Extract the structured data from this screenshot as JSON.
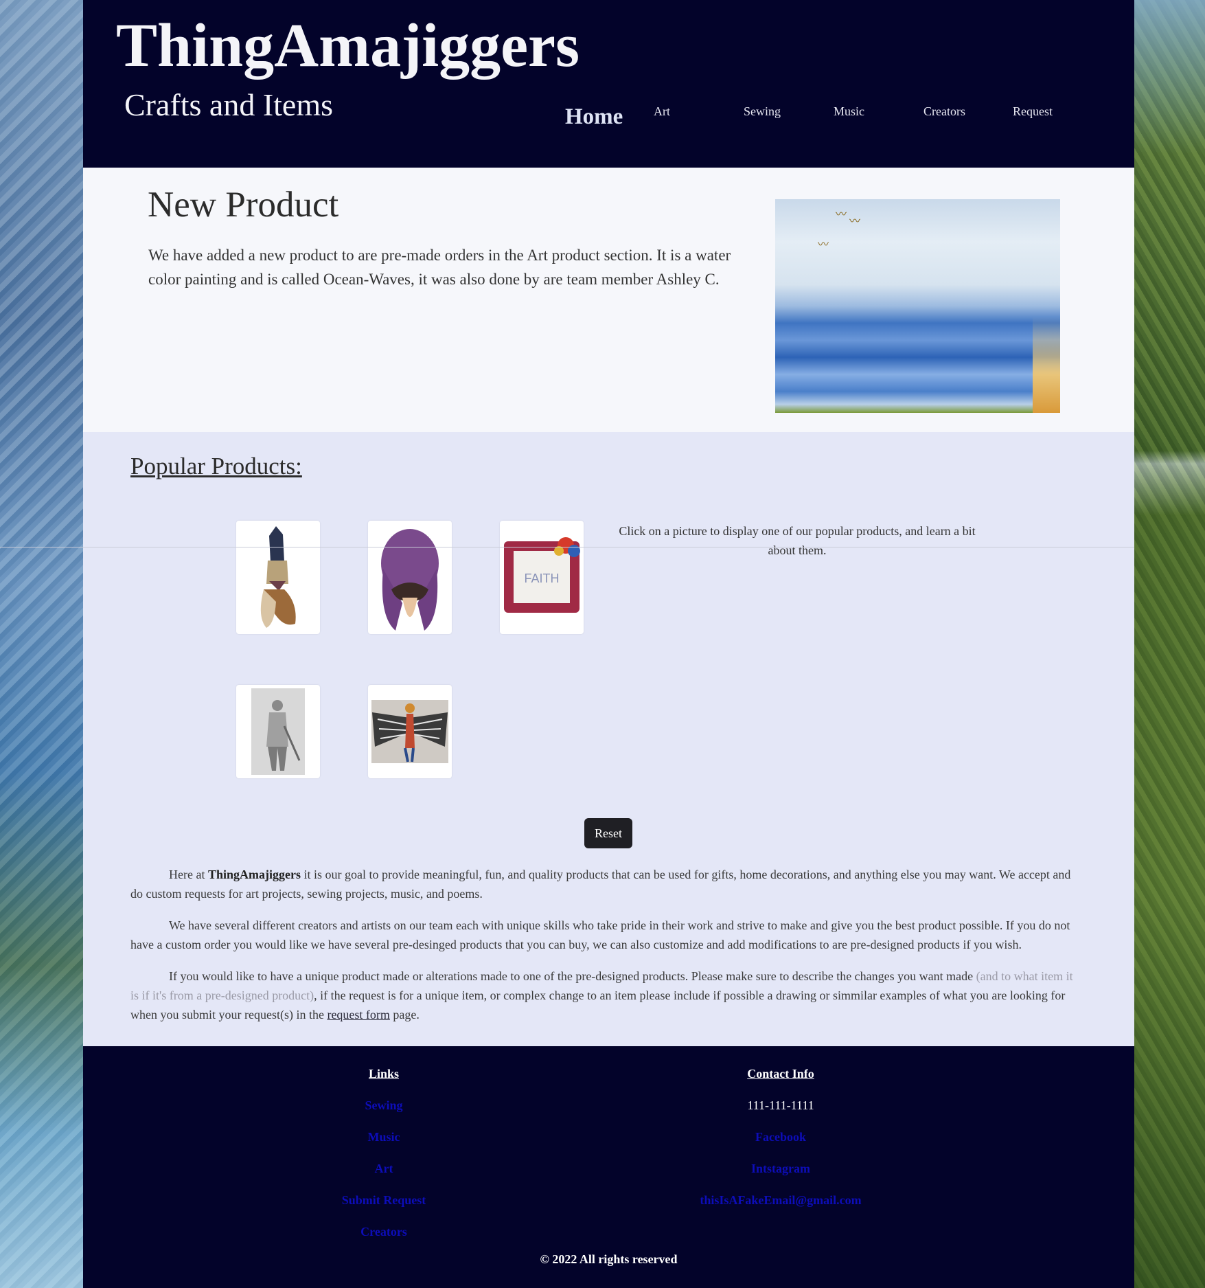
{
  "header": {
    "brand": "ThingAmajiggers",
    "tagline": "Crafts and Items",
    "nav": {
      "home": "Home",
      "art": "Art",
      "sewing": "Sewing",
      "music": "Music",
      "creators": "Creators",
      "request": "Request"
    }
  },
  "new_product": {
    "title": "New Product",
    "text": "We have added a new product to are pre-made orders in the Art product section. It is a water color painting and is called Ocean-Waves, it was also done by are team member Ashley C.",
    "image_icon": "ocean-waves-painting"
  },
  "popular": {
    "heading": "Popular Products:",
    "hint": "Click on a picture to display one of our popular products, and learn a bit about them.",
    "thumbs": [
      {
        "icon": "gnome-thumbnail"
      },
      {
        "icon": "purple-plush-thumbnail"
      },
      {
        "icon": "faith-pillow-thumbnail"
      },
      {
        "icon": "pencil-drawing-thumbnail"
      },
      {
        "icon": "winged-figure-thumbnail"
      }
    ],
    "pillow_text": "FAITH",
    "reset_label": "Reset"
  },
  "about": {
    "p1_pre": "Here at ",
    "p1_brand": "ThingAmajiggers",
    "p1_post": " it is our goal to provide meaningful, fun, and quality products that can be used for gifts, home decorations, and anything else you may want. We accept and do custom requests for art projects, sewing projects, music, and poems.",
    "p2": "We have several different creators and artists on our team each with unique skills who take pride in their work and strive to make and give you the best product possible. If you do not have a custom order you would like we have several pre-desinged products that you can buy, we can also customize and add modifications to are pre-designed products if you wish.",
    "p3_pre": "If you would like to have a unique product made or alterations made to one of the pre-designed products. Please make sure to describe the changes you want made ",
    "p3_muted": "(and to what item it is if it's from a pre-designed product)",
    "p3_mid": ", if the request is for a unique item, or complex change to an item please include if possible a drawing or simmilar examples of what you are looking for when you submit your request(s) in the ",
    "p3_link": "request form",
    "p3_post": " page."
  },
  "footer": {
    "links_heading": "Links",
    "links": [
      "Sewing",
      "Music",
      "Art",
      "Submit Request",
      "Creators"
    ],
    "contact_heading": "Contact Info",
    "phone": "111-111-1111",
    "contact_links": [
      "Facebook",
      "Intstagram",
      "thisIsAFakeEmail@gmail.com"
    ],
    "copyright": "© 2022 All rights reserved"
  },
  "colors": {
    "header_bg": "#03032a",
    "popular_bg": "#e4e7f7",
    "link_blue": "#0d0db8"
  }
}
